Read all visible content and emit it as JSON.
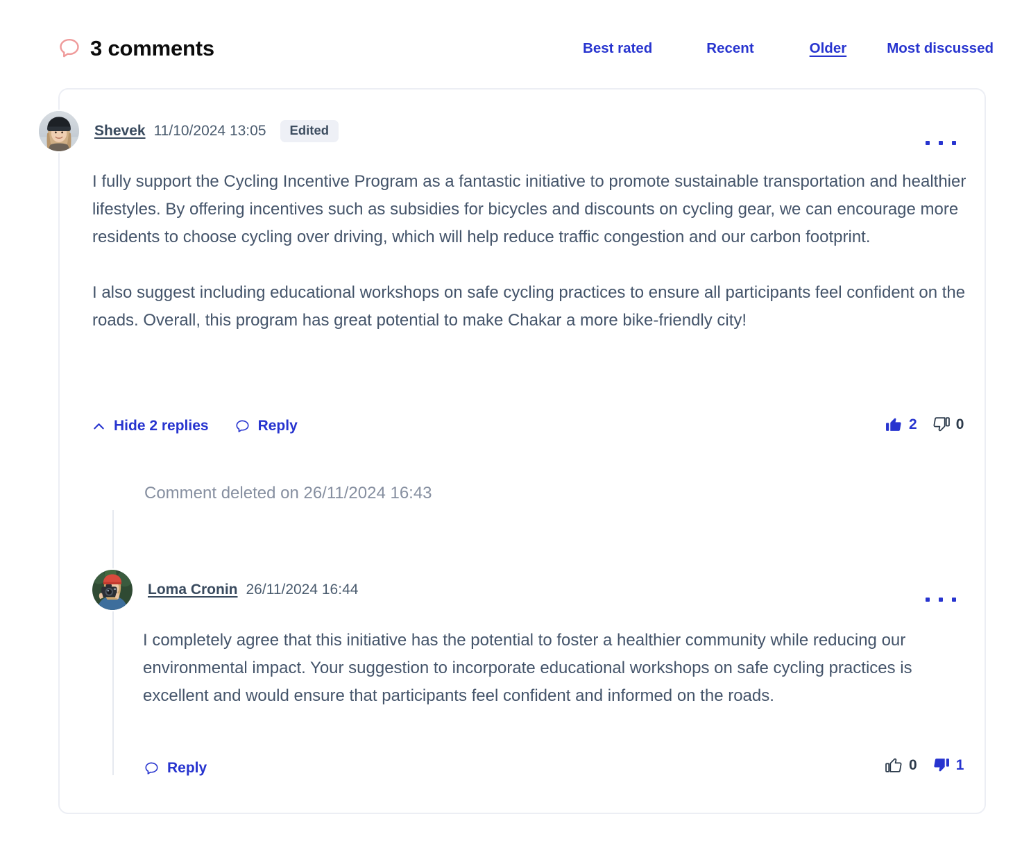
{
  "header": {
    "icon": "comment-bubble-icon",
    "icon_color": "#ef9a9a",
    "title": "3 comments",
    "sort_options": [
      {
        "label": "Best rated",
        "active": false
      },
      {
        "label": "Recent",
        "active": false
      },
      {
        "label": "Older",
        "active": true
      },
      {
        "label": "Most discussed",
        "active": false
      }
    ]
  },
  "accent_color": "#2734cf",
  "text_color": "#44546a",
  "muted_color": "#868fa0",
  "comments": [
    {
      "author": "Shevek",
      "timestamp": "11/10/2024 13:05",
      "badge": "Edited",
      "avatar_alt": "woman-with-black-beanie-avatar",
      "menu_icon": "ellipsis-icon",
      "paragraphs": [
        "I fully support the Cycling Incentive Program as a fantastic initiative to promote sustainable transportation and healthier lifestyles. By offering incentives such as subsidies for bicycles and discounts on cycling gear, we can encourage more residents to choose cycling over driving, which will help reduce traffic congestion and our carbon footprint.",
        "I also suggest including educational workshops on safe cycling practices to ensure all participants feel confident on the roads. Overall, this program has great potential to make Chakar a more bike-friendly city!"
      ],
      "actions": {
        "toggle_replies": "Hide 2 replies",
        "toggle_icon": "chevron-up-icon",
        "reply": "Reply",
        "reply_icon": "comment-bubble-icon"
      },
      "votes": {
        "up_count": "2",
        "up_state": "active",
        "up_icon": "thumbs-up-filled-icon",
        "down_count": "0",
        "down_state": "idle",
        "down_icon": "thumbs-down-outline-icon"
      }
    }
  ],
  "deleted_reply": {
    "text": "Comment deleted on 26/11/2024 16:43"
  },
  "reply": {
    "author": "Loma Cronin",
    "timestamp": "26/11/2024 16:44",
    "avatar_alt": "person-with-red-cap-and-camera-avatar",
    "menu_icon": "ellipsis-icon",
    "paragraphs": [
      "I completely agree that this initiative has the potential to foster a healthier community while reducing our environmental impact. Your suggestion to incorporate educational workshops on safe cycling practices is excellent and would ensure that participants feel confident and informed on the roads."
    ],
    "actions": {
      "reply": "Reply",
      "reply_icon": "comment-bubble-icon"
    },
    "votes": {
      "up_count": "0",
      "up_state": "idle",
      "up_icon": "thumbs-up-outline-icon",
      "down_count": "1",
      "down_state": "active",
      "down_icon": "thumbs-down-filled-icon"
    }
  }
}
